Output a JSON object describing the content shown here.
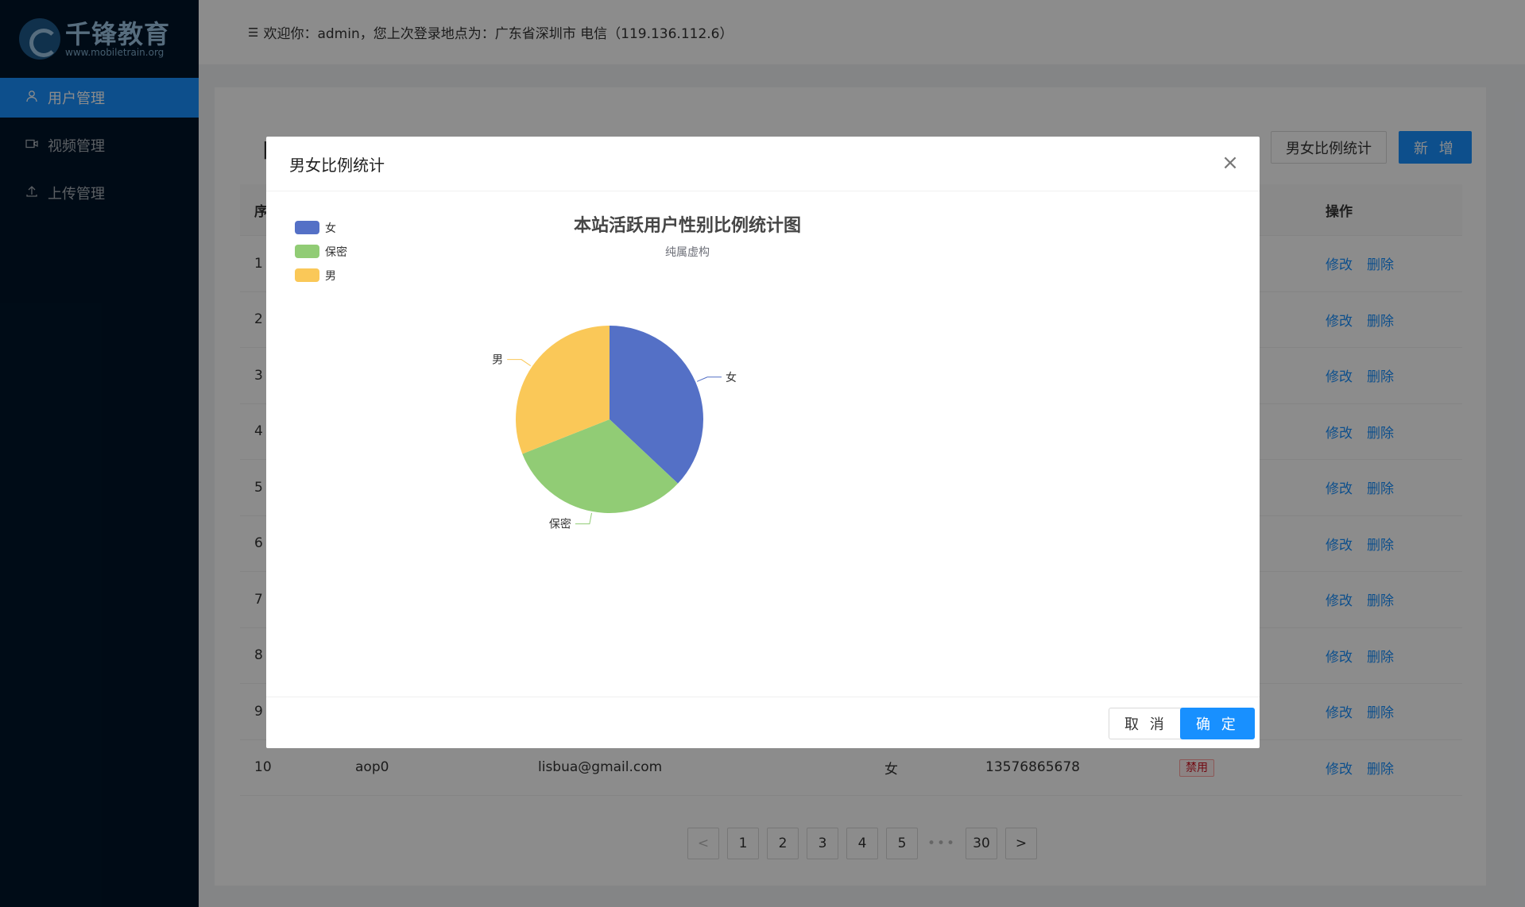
{
  "brand": {
    "name": "千锋教育",
    "url": "www.mobiletrain.org"
  },
  "sidebar": {
    "items": [
      {
        "label": "用户管理",
        "icon": "user-icon",
        "active": true
      },
      {
        "label": "视频管理",
        "icon": "video-icon",
        "active": false
      },
      {
        "label": "上传管理",
        "icon": "upload-icon",
        "active": false
      }
    ]
  },
  "header": {
    "welcome": "欢迎你：admin，您上次登录地点为：广东省深圳市 电信（119.136.112.6）"
  },
  "toolbar": {
    "stat_label": "男女比例统计",
    "add_label": "新 增"
  },
  "table": {
    "headers": {
      "index": "序",
      "ops": "操作"
    },
    "rows": [
      {
        "idx": "1"
      },
      {
        "idx": "2"
      },
      {
        "idx": "3"
      },
      {
        "idx": "4"
      },
      {
        "idx": "5"
      },
      {
        "idx": "6"
      },
      {
        "idx": "7"
      },
      {
        "idx": "8"
      },
      {
        "idx": "9"
      },
      {
        "idx": "10",
        "username": "aop0",
        "email": "lisbua@gmail.com",
        "gender": "女",
        "phone": "13576865678",
        "status": "禁用"
      }
    ],
    "edit_label": "修改",
    "delete_label": "删除"
  },
  "pagination": {
    "pages": [
      "1",
      "2",
      "3",
      "4",
      "5"
    ],
    "dots": "•••",
    "last": "30",
    "prev": "<",
    "next": ">"
  },
  "modal": {
    "title": "男女比例统计",
    "close": "×",
    "cancel_label": "取 消",
    "ok_label": "确 定"
  },
  "chart_data": {
    "type": "pie",
    "title": "本站活跃用户性别比例统计图",
    "subtitle": "纯属虚构",
    "legend_position": "top-left",
    "categories": [
      "女",
      "保密",
      "男"
    ],
    "values": [
      37,
      32,
      31
    ],
    "colors": [
      "#5470c6",
      "#91cc75",
      "#fac858"
    ]
  }
}
